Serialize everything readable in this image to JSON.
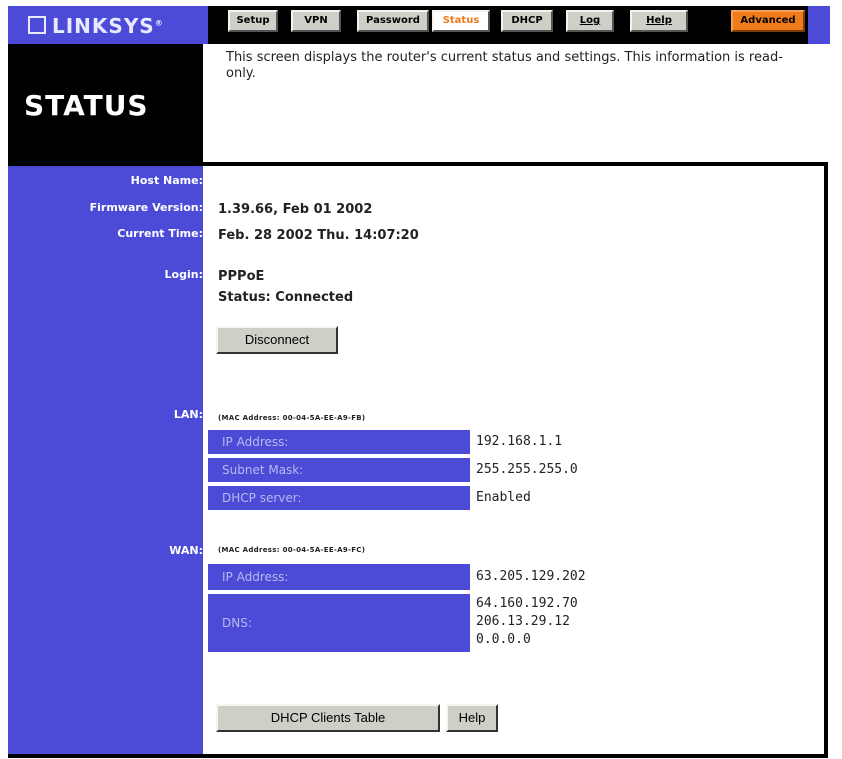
{
  "header": {
    "brand": "LINKSYS",
    "brand_mark": "®",
    "tabs": [
      {
        "label": "Setup",
        "state": "normal"
      },
      {
        "label": "VPN",
        "state": "normal"
      },
      {
        "label": "Password",
        "state": "normal"
      },
      {
        "label": "Status",
        "state": "active"
      },
      {
        "label": "DHCP",
        "state": "normal"
      },
      {
        "label": "Log",
        "state": "normal"
      },
      {
        "label": "Help",
        "state": "normal"
      },
      {
        "label": "Advanced",
        "state": "advanced"
      }
    ]
  },
  "page": {
    "title": "STATUS",
    "description": "This screen displays the router's current status and settings. This information is read-only."
  },
  "labels": {
    "host_name": "Host Name:",
    "firmware_version": "Firmware Version:",
    "current_time": "Current Time:",
    "login": "Login:",
    "lan": "LAN:",
    "wan": "WAN:"
  },
  "values": {
    "host_name": "",
    "firmware_version": "1.39.66, Feb 01 2002",
    "current_time": "Feb. 28 2002 Thu. 14:07:20",
    "login_type": "PPPoE",
    "login_status": "Status: Connected"
  },
  "buttons": {
    "disconnect": "Disconnect",
    "dhcp_clients_table": "DHCP Clients Table",
    "help": "Help"
  },
  "lan": {
    "mac": "(MAC Address: 00-04-5A-EE-A9-FB)",
    "rows": [
      {
        "label": "IP Address:",
        "value": "192.168.1.1"
      },
      {
        "label": "Subnet Mask:",
        "value": "255.255.255.0"
      },
      {
        "label": "DHCP server:",
        "value": "Enabled"
      }
    ]
  },
  "wan": {
    "mac": "(MAC Address: 00-04-5A-EE-A9-FC)",
    "ip_label": "IP Address:",
    "ip_value": "63.205.129.202",
    "dns_label": "DNS:",
    "dns_values": [
      "64.160.192.70",
      "206.13.29.12",
      "0.0.0.0"
    ]
  },
  "colors": {
    "sidebar": "#4b4bd8",
    "accent_orange": "#f07b1a",
    "button_gray": "#cfcfc7"
  }
}
